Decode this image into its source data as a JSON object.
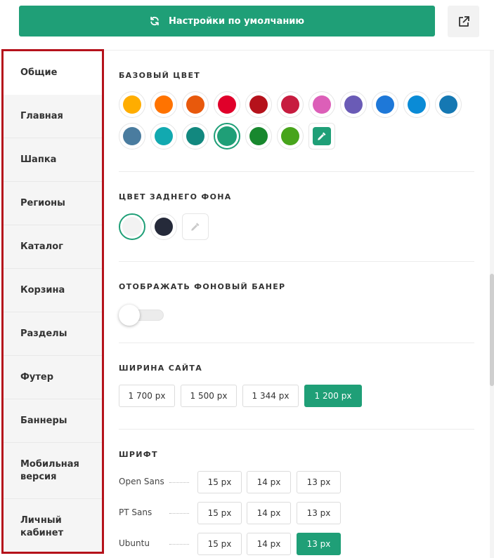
{
  "toolbar": {
    "defaults_label": "Настройки по умолчанию",
    "defaults_icon": "refresh-icon",
    "share_icon": "share-icon",
    "accent_color": "#1f9f77"
  },
  "sidebar": {
    "items": [
      {
        "label": "Общие",
        "active": true
      },
      {
        "label": "Главная"
      },
      {
        "label": "Шапка"
      },
      {
        "label": "Регионы"
      },
      {
        "label": "Каталог"
      },
      {
        "label": "Корзина"
      },
      {
        "label": "Разделы"
      },
      {
        "label": "Футер"
      },
      {
        "label": "Баннеры"
      },
      {
        "label": "Мобильная версия"
      },
      {
        "label": "Личный кабинет"
      }
    ]
  },
  "base_color": {
    "title": "БАЗОВЫЙ ЦВЕТ",
    "swatches": [
      "#ffad00",
      "#ff7300",
      "#e8590c",
      "#e0002a",
      "#b5121b",
      "#c71c3f",
      "#dc5fb8",
      "#6a5bb6",
      "#1e78d8",
      "#0a8bd6",
      "#1578b3",
      "#4a7c9f",
      "#12a9b0",
      "#12887f",
      "#1f9f77",
      "#18882e",
      "#47a41b"
    ],
    "selected": "#1f9f77",
    "picker_icon": "eyedropper-icon"
  },
  "bg_color": {
    "title": "ЦВЕТ ЗАДНЕГО ФОНА",
    "swatches": [
      "#f2f2f2",
      "#252a3a"
    ],
    "selected": "#f2f2f2",
    "picker_icon": "eyedropper-icon"
  },
  "bg_banner": {
    "title": "ОТОБРАЖАТЬ ФОНОВЫЙ БАНЕР",
    "enabled": false
  },
  "site_width": {
    "title": "ШИРИНА САЙТА",
    "options": [
      "1 700 px",
      "1 500 px",
      "1 344 px",
      "1 200 px"
    ],
    "selected": "1 200 px"
  },
  "font": {
    "title": "ШРИФТ",
    "rows": [
      {
        "name": "Open Sans",
        "sizes": [
          "15 px",
          "14 px",
          "13 px"
        ],
        "selected": null
      },
      {
        "name": "PT Sans",
        "sizes": [
          "15 px",
          "14 px",
          "13 px"
        ],
        "selected": null
      },
      {
        "name": "Ubuntu",
        "sizes": [
          "15 px",
          "14 px",
          "13 px"
        ],
        "selected": "13 px"
      }
    ]
  }
}
